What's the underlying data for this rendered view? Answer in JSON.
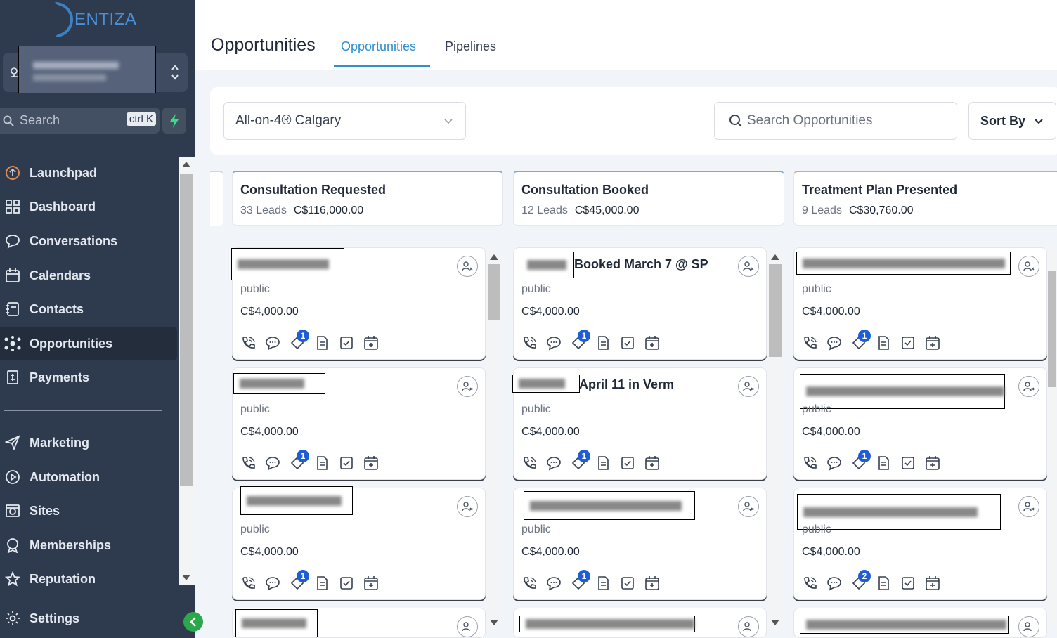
{
  "brand": {
    "logo_text": "ENTIZA",
    "accent": "#2f8fd1",
    "sidebar_bg": "#2e3a4e"
  },
  "sidebar": {
    "search_label": "Search",
    "search_shortcut": "ctrl K",
    "items": [
      {
        "label": "Launchpad",
        "icon": "rocket-icon"
      },
      {
        "label": "Dashboard",
        "icon": "grid-icon"
      },
      {
        "label": "Conversations",
        "icon": "chat-icon"
      },
      {
        "label": "Calendars",
        "icon": "calendar-icon"
      },
      {
        "label": "Contacts",
        "icon": "contacts-icon"
      },
      {
        "label": "Opportunities",
        "icon": "network-icon",
        "active": true
      },
      {
        "label": "Payments",
        "icon": "payments-icon"
      },
      {
        "label": "Marketing",
        "icon": "send-icon"
      },
      {
        "label": "Automation",
        "icon": "play-circle-icon"
      },
      {
        "label": "Sites",
        "icon": "globe-icon"
      },
      {
        "label": "Memberships",
        "icon": "award-icon"
      },
      {
        "label": "Reputation",
        "icon": "star-icon"
      },
      {
        "label": "Settings",
        "icon": "gear-icon"
      }
    ]
  },
  "header": {
    "title": "Opportunities",
    "tabs": [
      {
        "label": "Opportunities",
        "active": true
      },
      {
        "label": "Pipelines"
      }
    ]
  },
  "filters": {
    "pipeline": "All-on-4® Calgary",
    "search_placeholder": "Search Opportunities",
    "sort_label": "Sort By"
  },
  "columns": [
    {
      "title": "Consultation Requested",
      "leads": "33 Leads",
      "amount": "C$116,000.00",
      "accent": "#7fa6dc"
    },
    {
      "title": "Consultation Booked",
      "leads": "12 Leads",
      "amount": "C$45,000.00",
      "accent": "#7fa6dc"
    },
    {
      "title": "Treatment Plan Presented",
      "leads": "9 Leads",
      "amount": "C$30,760.00",
      "accent": "#f0a35e"
    }
  ],
  "cards": [
    [
      {
        "name_visible": "",
        "source": "public",
        "value": "C$4,000.00",
        "badge": "1"
      },
      {
        "name_visible": "",
        "source": "public",
        "value": "C$4,000.00",
        "badge": "1"
      },
      {
        "name_visible": "",
        "source": "public",
        "value": "C$4,000.00",
        "badge": "1"
      }
    ],
    [
      {
        "name_visible": "Booked March 7 @ SP",
        "source": "public",
        "value": "C$4,000.00",
        "badge": "1"
      },
      {
        "name_visible": "April 11 in Verm",
        "source": "public",
        "value": "C$4,000.00",
        "badge": "1"
      },
      {
        "name_visible": "",
        "source": "public",
        "value": "C$4,000.00",
        "badge": "1"
      }
    ],
    [
      {
        "name_visible": "",
        "source": "public",
        "value": "C$4,000.00",
        "badge": "1"
      },
      {
        "name_visible": "",
        "source": "public",
        "value": "C$4,000.00",
        "badge": "1"
      },
      {
        "name_visible": "",
        "source": "public",
        "value": "C$4,000.00",
        "badge": "2"
      }
    ]
  ]
}
